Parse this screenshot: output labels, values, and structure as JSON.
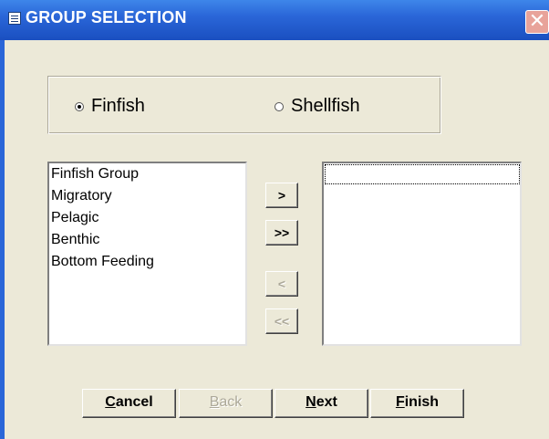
{
  "window": {
    "title": "GROUP SELECTION",
    "close_glyph": "✕"
  },
  "radio_group": {
    "options": [
      {
        "label": "Finfish",
        "selected": true
      },
      {
        "label": "Shellfish",
        "selected": false
      }
    ]
  },
  "left_list": {
    "items": [
      "Finfish Group",
      "Migratory",
      "Pelagic",
      "Benthic",
      "Bottom Feeding"
    ]
  },
  "right_list": {
    "items": []
  },
  "move_buttons": {
    "add_one": ">",
    "add_all": ">>",
    "remove_one": "<",
    "remove_all": "<<"
  },
  "footer": {
    "cancel": {
      "access_key": "C",
      "rest": "ancel"
    },
    "back": {
      "access_key": "B",
      "rest": "ack"
    },
    "next": {
      "access_key": "N",
      "rest": "ext"
    },
    "finish": {
      "access_key": "F",
      "rest": "inish"
    }
  },
  "colors": {
    "title_bar": "#2a66d8",
    "dialog_bg": "#ece9d8",
    "disabled_text": "#aca899"
  },
  "icons": {
    "title": "form-icon",
    "close": "close-icon"
  }
}
